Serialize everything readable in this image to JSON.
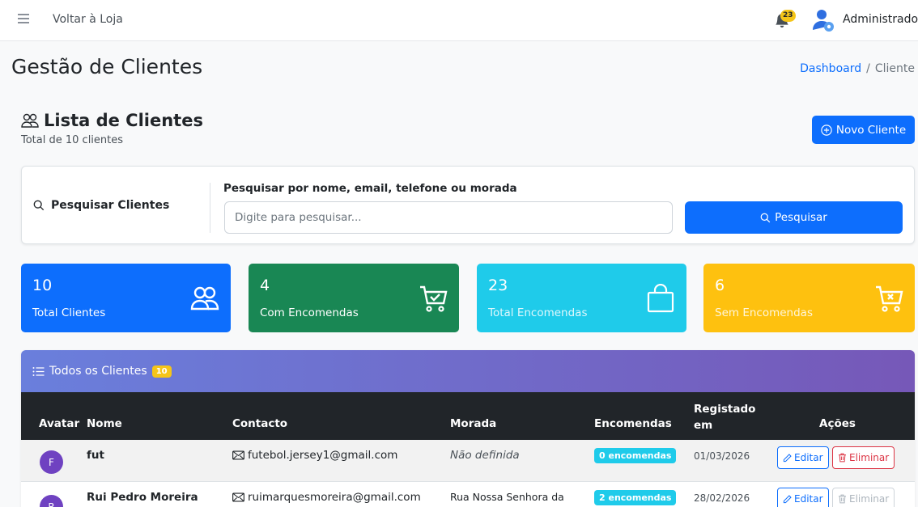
{
  "topbar": {
    "back_label": "Voltar à Loja",
    "notifications_count": "23",
    "user_name": "Administrador"
  },
  "page": {
    "title": "Gestão de Clientes",
    "breadcrumb": [
      "Dashboard",
      "Cliente"
    ]
  },
  "section": {
    "title": "Lista de Clientes",
    "subtitle": "Total de 10 clientes",
    "new_button": "Novo Cliente"
  },
  "search": {
    "label": "Pesquisar Clientes",
    "field_label": "Pesquisar por nome, email, telefone ou morada",
    "placeholder": "Digite para pesquisar...",
    "value": "",
    "button": "Pesquisar"
  },
  "stats": [
    {
      "value": "10",
      "label": "Total Clientes",
      "icon": "people-icon",
      "color": "#0d6efd"
    },
    {
      "value": "4",
      "label": "Com Encomendas",
      "icon": "cart-check-icon",
      "color": "#198754"
    },
    {
      "value": "23",
      "label": "Total Encomendas",
      "icon": "bag-icon",
      "color": "#1fcbea"
    },
    {
      "value": "6",
      "label": "Sem Encomendas",
      "icon": "cart-x-icon",
      "color": "#fec10f"
    }
  ],
  "table": {
    "title": "Todos os Clientes",
    "count": "10",
    "columns": [
      "Avatar",
      "Nome",
      "Contacto",
      "Morada",
      "Encomendas",
      "Registado em",
      "Ações"
    ],
    "rows": [
      {
        "initial": "F",
        "name": "fut",
        "email": "futebol.jersey1@gmail.com",
        "address": "Não definida",
        "orders": "0 encomendas",
        "registered": "01/03/2026",
        "edit": "Editar",
        "delete": "Eliminar",
        "delete_enabled": true
      },
      {
        "initial": "R",
        "name": "Rui Pedro Moreira",
        "email": "ruimarquesmoreira@gmail.com",
        "address": "Rua Nossa Senhora da",
        "orders": "2 encomendas",
        "registered": "28/02/2026",
        "edit": "Editar",
        "delete": "Eliminar",
        "delete_enabled": false
      }
    ]
  }
}
